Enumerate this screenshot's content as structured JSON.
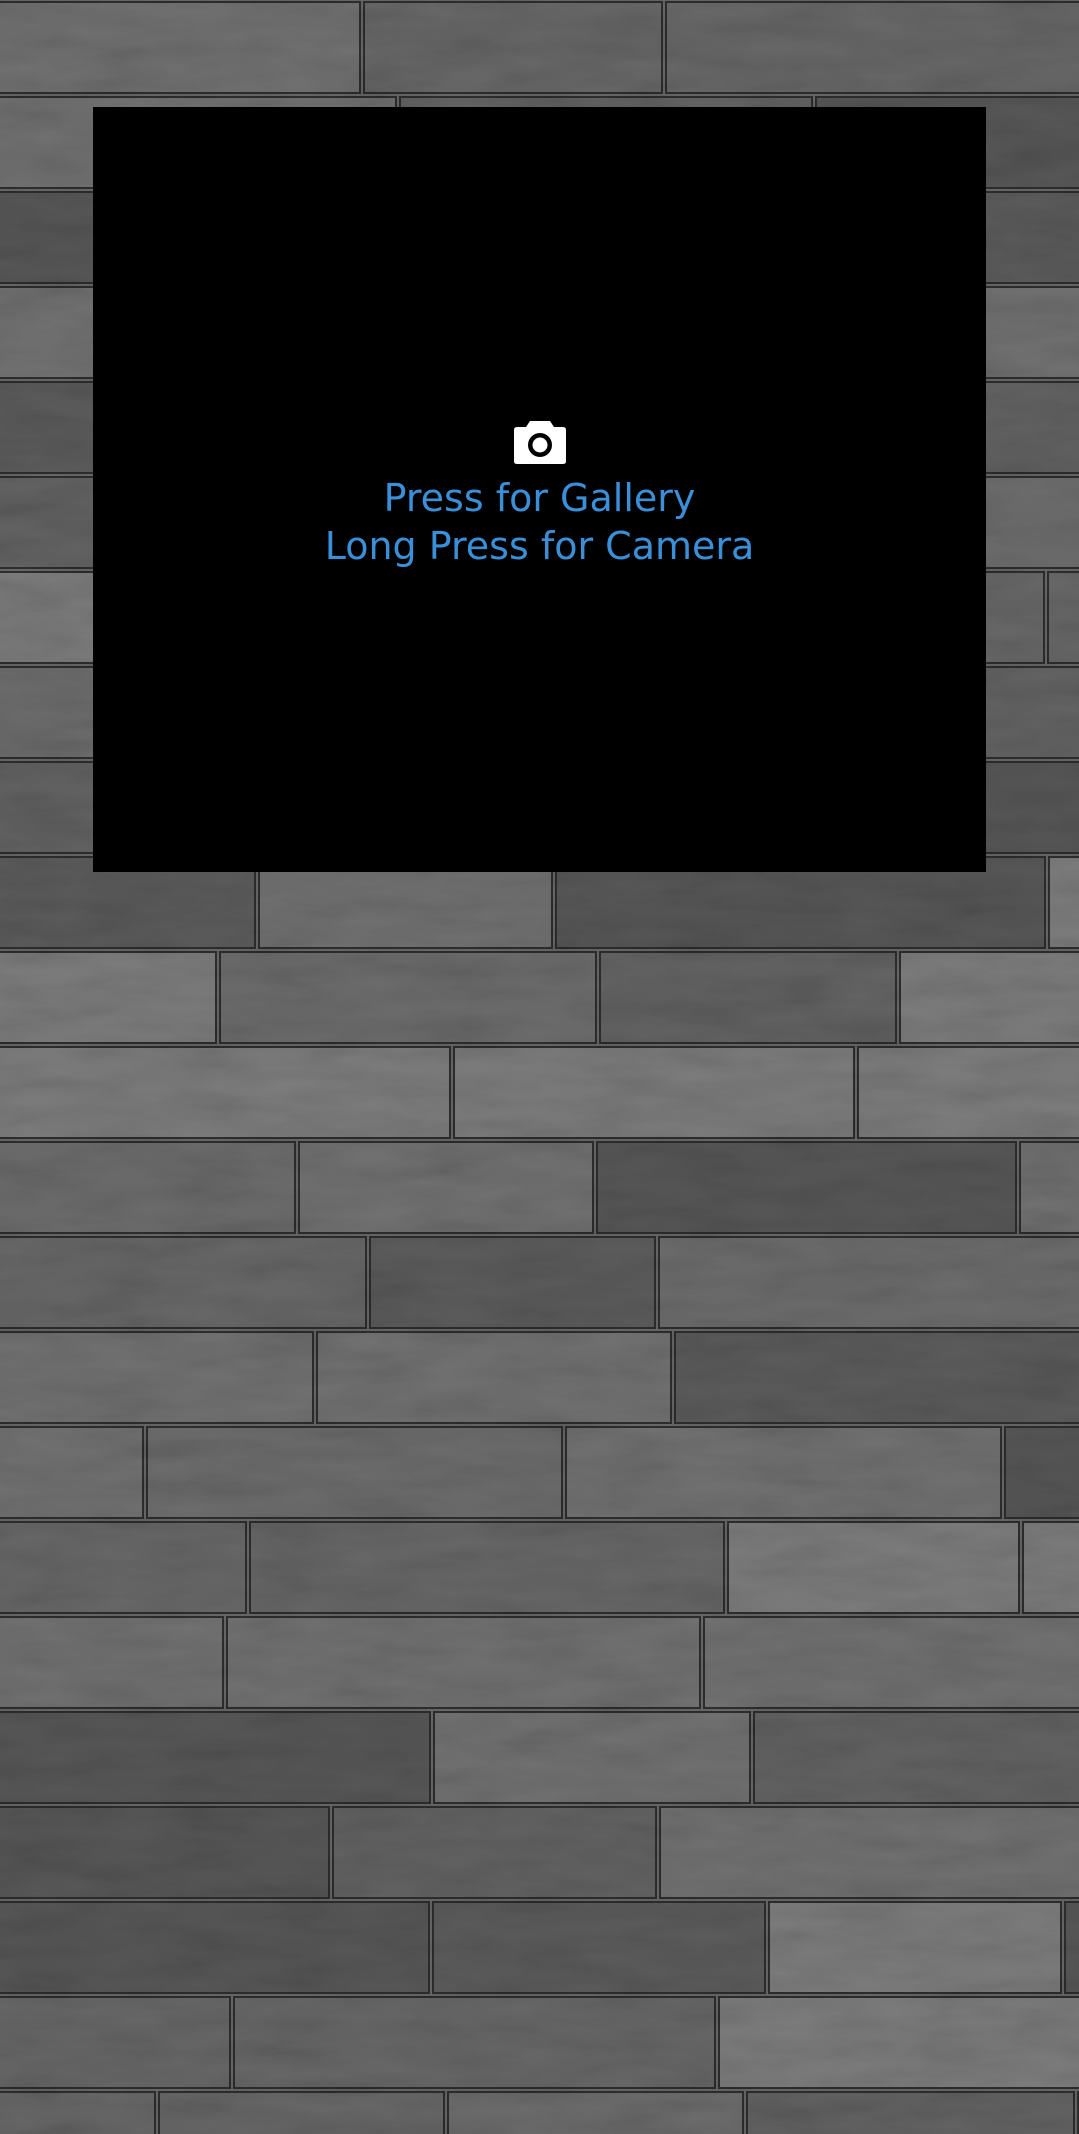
{
  "picker": {
    "icon": "camera-icon",
    "line1": "Press for Gallery",
    "line2": "Long Press for Camera"
  },
  "colors": {
    "hint_text": "#3a8fd9",
    "picker_background": "#000000",
    "icon": "#ffffff",
    "wall_base": "#6b6b6b",
    "wall_mortar": "#2e2e2e"
  },
  "background": {
    "icon": "stone-wall-texture"
  }
}
